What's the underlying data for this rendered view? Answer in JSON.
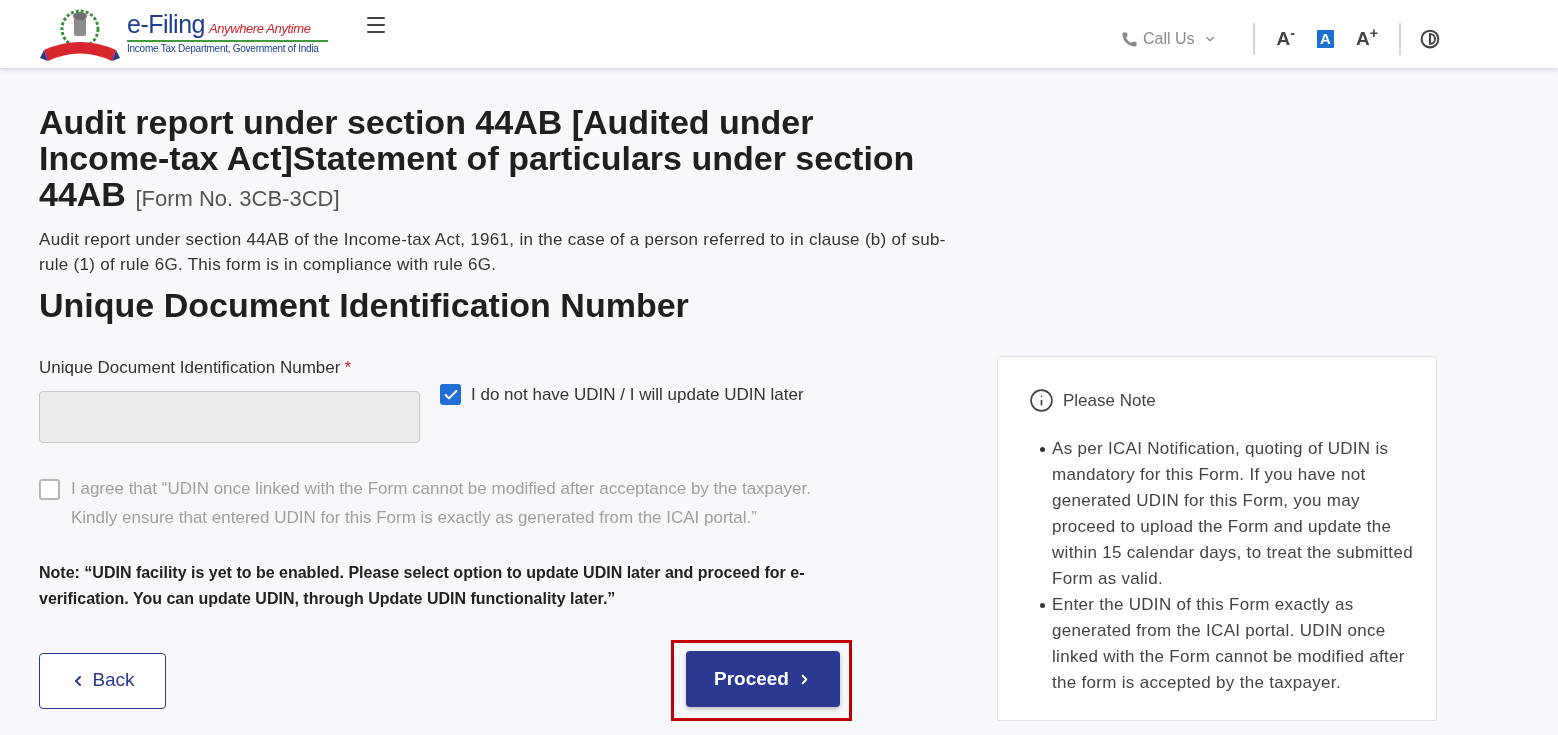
{
  "header": {
    "logo": {
      "title": "e-Filing",
      "tagline": "Anywhere Anytime",
      "subtitle": "Income Tax Department, Government of India"
    },
    "call_us": "Call Us",
    "font_size_controls": [
      {
        "label": "A$^{-}$",
        "selected": false
      },
      {
        "label": "A",
        "selected": true
      },
      {
        "label": "A$^{+}$",
        "selected": false
      }
    ]
  },
  "page": {
    "title": "Audit report under section 44AB [Audited under Income-tax Act]Statement of particulars under section 44AB",
    "form_number": "[Form No. 3CB-3CD]",
    "description": "Audit report under section 44AB of the Income-tax Act, 1961, in the case of a person referred to in clause (b) of sub-rule (1) of rule 6G. This form is in compliance with rule 6G.",
    "section_title": "Unique Document Identification Number"
  },
  "udin_field": {
    "label": "Unique Document Identification Number",
    "required_mark": "*",
    "disabled": true
  },
  "checkboxes": [
    {
      "label": "I do not have UDIN / I will update UDIN later",
      "checked": true,
      "disabled": false
    },
    {
      "label": "I agree that “UDIN once linked with the Form cannot be modified after acceptance by the taxpayer. Kindly ensure that entered UDIN for this Form is exactly as generated from the ICAI portal.”",
      "checked": false,
      "disabled": true
    }
  ],
  "note": "Note: “UDIN facility is yet to be enabled. Please select option to update UDIN later and proceed for e-verification. You can update UDIN, through Update UDIN functionality later.”",
  "buttons": [
    {
      "kind": "back",
      "label": "Back",
      "highlighted": false
    },
    {
      "kind": "proceed",
      "label": "Proceed",
      "highlighted": true
    }
  ],
  "info_panel": {
    "title": "Please Note",
    "items": [
      "As per ICAI Notification, quoting of UDIN is mandatory for this Form. If you have not generated UDIN for this Form, you may proceed to upload the Form and update the within 15 calendar days, to treat the submitted Form as valid.",
      "Enter the UDIN of this Form exactly as generated from the ICAI portal. UDIN once linked with the Form cannot be modified after the form is accepted by the taxpayer."
    ]
  }
}
